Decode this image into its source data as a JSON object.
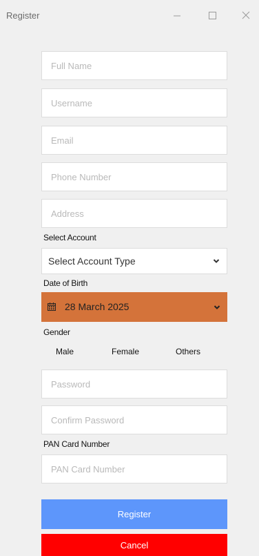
{
  "window": {
    "title": "Register",
    "controls": [
      "minimize-icon",
      "maximize-icon",
      "close-icon"
    ]
  },
  "form": {
    "full_name_placeholder": "Full Name",
    "username_placeholder": "Username",
    "email_placeholder": "Email",
    "phone_placeholder": "Phone Number",
    "address_placeholder": "Address",
    "select_account_label": "Select Account",
    "account_type_value": "Select Account Type",
    "dob_label": "Date of Birth",
    "dob_value": "28 March 2025",
    "gender_label": "Gender",
    "gender_options": [
      "Male",
      "Female",
      "Others"
    ],
    "password_placeholder": "Password",
    "confirm_password_placeholder": "Confirm Password",
    "pan_label": "PAN Card Number",
    "pan_placeholder": "PAN Card Number",
    "register_label": "Register",
    "cancel_label": "Cancel"
  },
  "colors": {
    "background": "#f0f0f0",
    "date_picker": "#d4733a",
    "register_button": "#5d96fb",
    "cancel_button": "#ff0000"
  }
}
